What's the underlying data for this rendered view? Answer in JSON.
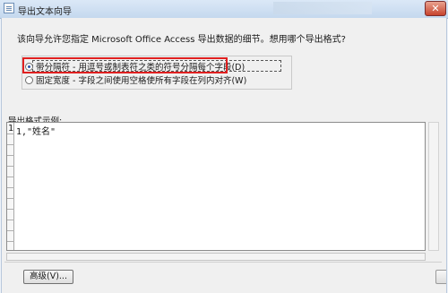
{
  "window": {
    "title": "导出文本向导",
    "close_glyph": "✕"
  },
  "intro_text": "该向导允许您指定 Microsoft Office Access 导出数据的细节。想用哪个导出格式?",
  "format_options": [
    {
      "label": "带分隔符 - 用逗号或制表符之类的符号分隔每个字段(D)",
      "checked": true
    },
    {
      "label": "固定宽度 - 字段之间使用空格使所有字段在列内对齐(W)",
      "checked": false
    }
  ],
  "sample": {
    "label": "导出格式示例:",
    "row_number": "1",
    "rows": [
      "1,\"姓名\""
    ]
  },
  "buttons": {
    "advanced": "高级(V)..."
  },
  "colors": {
    "highlight_box": "#e02020",
    "close_button": "#c7432d"
  }
}
